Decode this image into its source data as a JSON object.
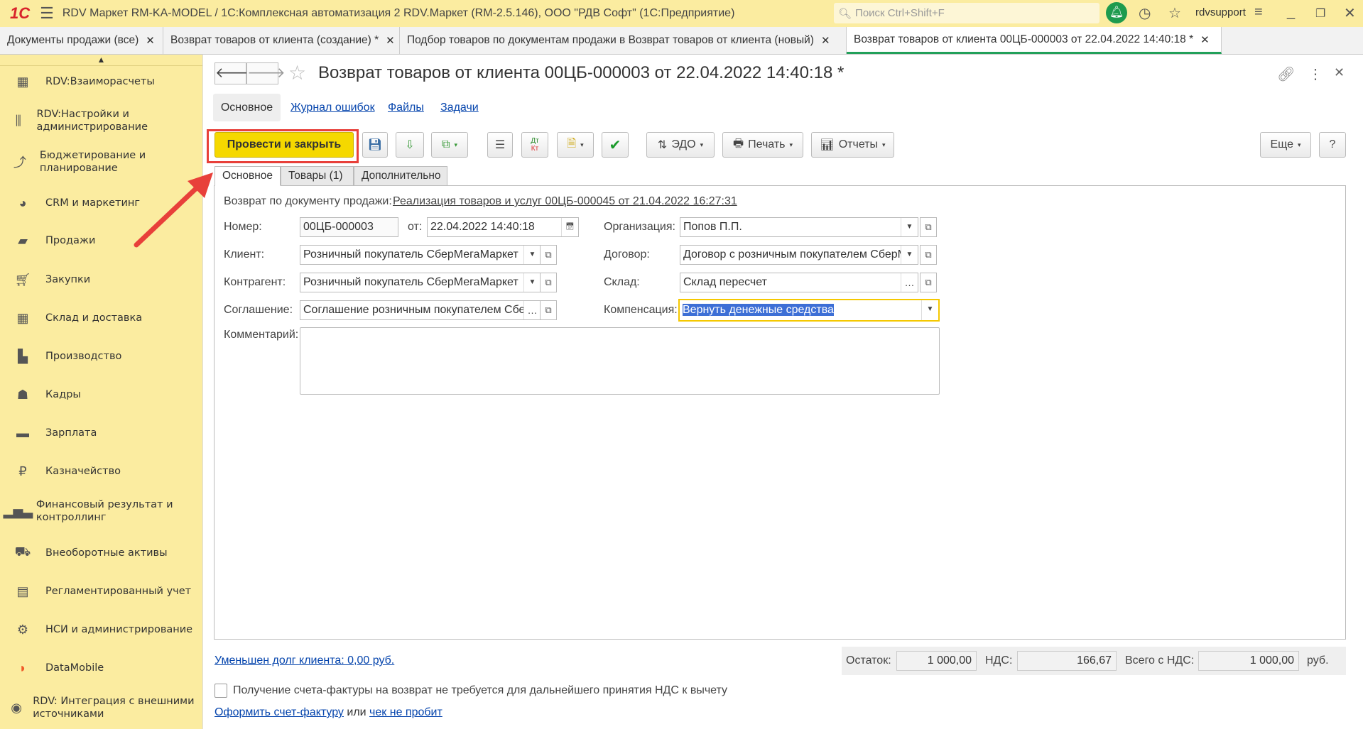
{
  "window": {
    "title": "RDV Маркет RM-KA-MODEL / 1С:Комплексная автоматизация 2 RDV.Маркет (RM-2.5.146), ООО \"РДВ Софт\"  (1С:Предприятие)",
    "search_placeholder": "Поиск Ctrl+Shift+F",
    "user": "rdvsupport",
    "logo": "1С"
  },
  "open_tabs": [
    {
      "label": "Документы продажи (все)"
    },
    {
      "label": "Возврат товаров от клиента (создание) *"
    },
    {
      "label": "Подбор товаров по документам продажи в Возврат товаров от клиента (новый)"
    },
    {
      "label": "Возврат товаров от клиента 00ЦБ-000003 от 22.04.2022 14:40:18 *"
    }
  ],
  "sidebar": {
    "items": [
      {
        "label": "RDV:Взаиморасчеты",
        "icon": "calculator-icon"
      },
      {
        "label": "RDV:Настройки и администрирование",
        "icon": "sliders-icon"
      },
      {
        "label": "Бюджетирование и планирование",
        "icon": "budget-icon"
      },
      {
        "label": "CRM и маркетинг",
        "icon": "pie-icon"
      },
      {
        "label": "Продажи",
        "icon": "bag-icon"
      },
      {
        "label": "Закупки",
        "icon": "cart-icon"
      },
      {
        "label": "Склад и доставка",
        "icon": "warehouse-icon"
      },
      {
        "label": "Производство",
        "icon": "factory-icon"
      },
      {
        "label": "Кадры",
        "icon": "person-icon"
      },
      {
        "label": "Зарплата",
        "icon": "card-icon"
      },
      {
        "label": "Казначейство",
        "icon": "ruble-icon"
      },
      {
        "label": "Финансовый результат и контроллинг",
        "icon": "bar-chart-icon"
      },
      {
        "label": "Внеоборотные активы",
        "icon": "truck-icon"
      },
      {
        "label": "Регламентированный учет",
        "icon": "register-icon"
      },
      {
        "label": "НСИ и администрирование",
        "icon": "gear-icon"
      },
      {
        "label": "DataMobile",
        "icon": "datamobile-icon"
      },
      {
        "label": "RDV: Интеграция с внешними источниками",
        "icon": "integration-icon"
      }
    ]
  },
  "doc": {
    "title": "Возврат товаров от клиента 00ЦБ-000003 от 22.04.2022 14:40:18 *",
    "nav": [
      "Основное",
      "Журнал ошибок",
      "Файлы",
      "Задачи"
    ],
    "toolbar": {
      "post_close": "Провести и закрыть",
      "edo": "ЭДО",
      "print": "Печать",
      "reports": "Отчеты",
      "more": "Еще",
      "help": "?",
      "dtkt_top": "Дт",
      "dtkt_bottom": "Кт"
    },
    "tabs": [
      "Основное",
      "Товары (1)",
      "Дополнительно"
    ],
    "form": {
      "base_label": "Возврат по документу продажи:",
      "base_link": "Реализация товаров и услуг 00ЦБ-000045 от 21.04.2022 16:27:31",
      "number_label": "Номер:",
      "number": "00ЦБ-000003",
      "from_label": "от:",
      "date": "22.04.2022 14:40:18",
      "org_label": "Организация:",
      "org": "Попов П.П.",
      "client_label": "Клиент:",
      "client": "Розничный покупатель СберМегаМаркет",
      "contract_label": "Договор:",
      "contract": "Договор с розничным покупателем СберМ",
      "counterparty_label": "Контрагент:",
      "counterparty": "Розничный покупатель СберМегаМаркет",
      "warehouse_label": "Склад:",
      "warehouse": "Склад пересчет",
      "agreement_label": "Соглашение:",
      "agreement": "Соглашение розничным покупателем Сбер",
      "compensation_label": "Компенсация:",
      "compensation": "Вернуть денежные средства",
      "comment_label": "Комментарий:",
      "comment": ""
    },
    "footer": {
      "debt_link": "Уменьшен долг клиента: 0,00 руб.",
      "balance_label": "Остаток:",
      "balance": "1 000,00",
      "vat_label": "НДС:",
      "vat": "166,67",
      "total_label": "Всего с НДС:",
      "total": "1 000,00",
      "currency": "руб.",
      "invoice_checkbox": "Получение счета-фактуры на возврат не требуется для дальнейшего принятия НДС к вычету",
      "invoice_checked": false,
      "invoice_link": "Оформить счет-фактуру",
      "or": "или",
      "receipt_link": "чек не пробит"
    }
  },
  "colors": {
    "accent_yellow": "#f5d800",
    "sidebar": "#fbeca0",
    "annotation_red": "#e8403a",
    "active_tab": "#22a05a"
  }
}
